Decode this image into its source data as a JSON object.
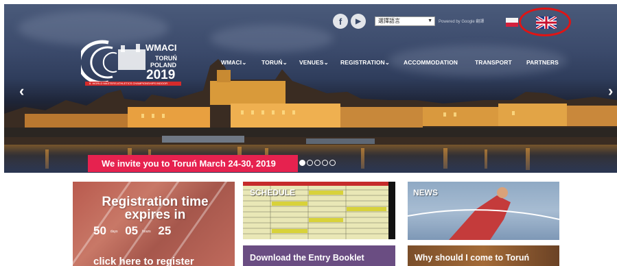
{
  "header": {
    "social": [
      {
        "name": "facebook",
        "glyph": "f"
      },
      {
        "name": "youtube",
        "glyph": "▶"
      }
    ],
    "language_select": {
      "value": "選擇語言"
    },
    "powered_by": "Powered by Google 翻譯",
    "flags": [
      "pl",
      "uk"
    ]
  },
  "logo": {
    "line1": "WMACI",
    "line2": "TORUŃ",
    "line3": "POLAND",
    "year": "2019",
    "band_text": "8. WORLD MASTERS ATHLETICS CHAMPIONSHIPS INDOOR"
  },
  "nav": [
    {
      "label": "WMACI",
      "has_dropdown": true
    },
    {
      "label": "TORUŃ",
      "has_dropdown": true
    },
    {
      "label": "VENUES",
      "has_dropdown": true
    },
    {
      "label": "REGISTRATION",
      "has_dropdown": true
    },
    {
      "label": "ACCOMMODATION",
      "has_dropdown": false
    },
    {
      "label": "TRANSPORT",
      "has_dropdown": false
    },
    {
      "label": "PARTNERS",
      "has_dropdown": false
    }
  ],
  "slider": {
    "prev_glyph": "‹",
    "next_glyph": "›",
    "banner_text": "We invite you to Toruń March 24-30, 2019",
    "dot_count": 5,
    "active_dot": 0
  },
  "tiles": {
    "registration": {
      "title_line1": "Registration time",
      "title_line2": "expires in",
      "days": "50",
      "days_unit": "days",
      "hours": "05",
      "hours_unit": "hours",
      "minutes": "25",
      "cta": "click here to register"
    },
    "schedule": {
      "label": "SCHEDULE"
    },
    "news": {
      "label": "NEWS"
    },
    "entry_booklet": {
      "label": "Download the Entry Booklet"
    },
    "why": {
      "label": "Why should I come to Toruń"
    }
  },
  "colors": {
    "accent_red": "#e6224f",
    "annotation_red": "#e01414",
    "booklet_purple": "#6a4d82"
  }
}
